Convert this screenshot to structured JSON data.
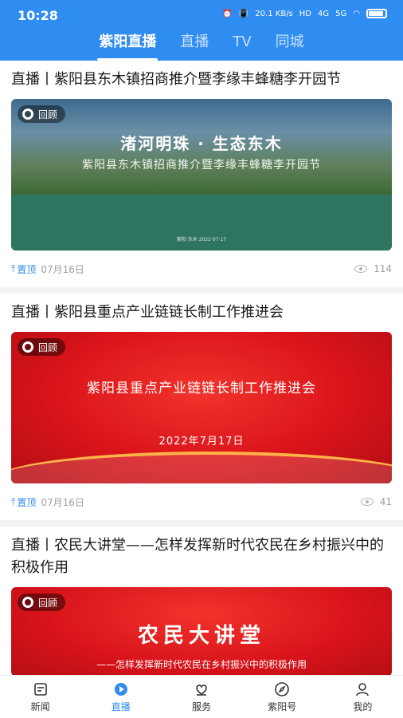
{
  "status_bar": {
    "time": "10:28",
    "speed": "20.1 KB/s",
    "hd": "HD",
    "net1": "4G",
    "net2": "5G"
  },
  "top_tabs": [
    {
      "label": "紫阳直播",
      "active": true
    },
    {
      "label": "直播",
      "active": false
    },
    {
      "label": "TV",
      "active": false
    },
    {
      "label": "同城",
      "active": false
    }
  ],
  "feed": [
    {
      "title": "直播丨紫阳县东木镇招商推介暨李缘丰蜂糖李开园节",
      "badge": "回顾",
      "thumb_heading": "渚河明珠 · 生态东木",
      "thumb_subheading": "紫阳县东木镇招商推介暨李缘丰蜂糖李开园节",
      "thumb_small": "紫阳·东木  2022·07·17",
      "pinned_label": "置顶",
      "date": "07月16日",
      "views": "114"
    },
    {
      "title": "直播丨紫阳县重点产业链链长制工作推进会",
      "badge": "回顾",
      "thumb_heading": "紫阳县重点产业链链长制工作推进会",
      "thumb_date": "2022年7月17日",
      "pinned_label": "置顶",
      "date": "07月16日",
      "views": "41"
    },
    {
      "title": "直播丨农民大讲堂——怎样发挥新时代农民在乡村振兴中的积极作用",
      "badge": "回顾",
      "thumb_heading": "农民大讲堂",
      "thumb_subheading": "——怎样发挥新时代农民在乡村振兴中的积极作用"
    }
  ],
  "bottom_nav": [
    {
      "label": "新闻",
      "icon": "news-icon",
      "active": false
    },
    {
      "label": "直播",
      "icon": "live-icon",
      "active": true
    },
    {
      "label": "服务",
      "icon": "service-icon",
      "active": false
    },
    {
      "label": "紫阳号",
      "icon": "compass-icon",
      "active": false
    },
    {
      "label": "我的",
      "icon": "profile-icon",
      "active": false
    }
  ],
  "colors": {
    "accent": "#2f8cf0",
    "divider": "#f2f3f5"
  }
}
